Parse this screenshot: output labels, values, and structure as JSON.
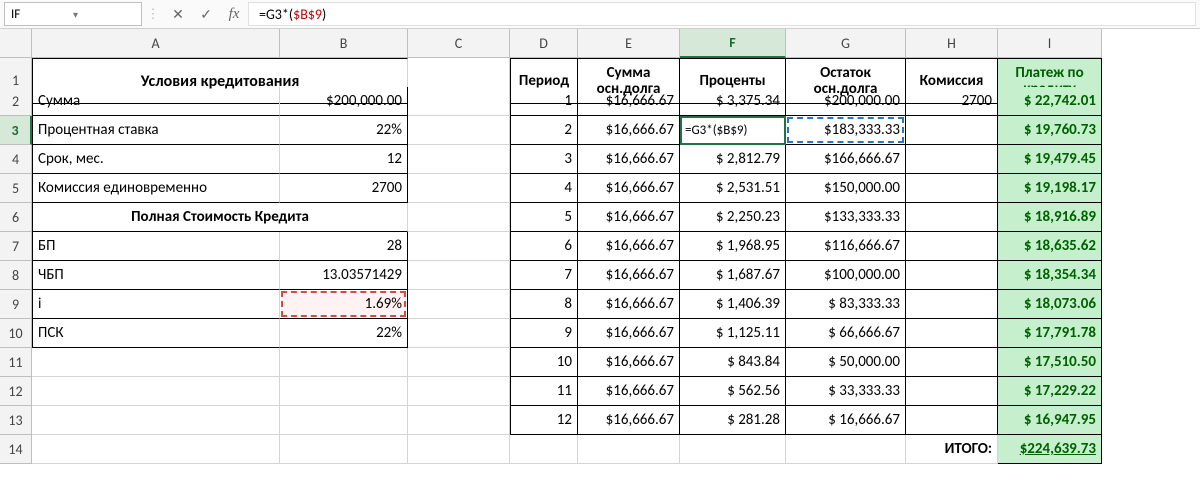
{
  "namebox": "IF",
  "formula": {
    "raw": "=G3*($B$9)",
    "prefix": "=G3*(",
    "abs": "$B$9",
    "suffix": ")"
  },
  "columns": [
    "A",
    "B",
    "C",
    "D",
    "E",
    "F",
    "G",
    "H",
    "I"
  ],
  "activeCol": "F",
  "rows": [
    "1",
    "2",
    "3",
    "4",
    "5",
    "6",
    "7",
    "8",
    "9",
    "10",
    "11",
    "12",
    "13",
    "14"
  ],
  "activeRow": "3",
  "left": {
    "title": "Условия кредитования",
    "rows": [
      {
        "label": "Сумма",
        "value": "$200,000.00"
      },
      {
        "label": "Процентная ставка",
        "value": "22%"
      },
      {
        "label": "Срок, мес.",
        "value": "12"
      },
      {
        "label": "Комиссия единовременно",
        "value": "2700"
      }
    ],
    "sub_title": "Полная Стоимость Кредита",
    "rows2": [
      {
        "label": "БП",
        "value": "28"
      },
      {
        "label": "ЧБП",
        "value": "13.03571429"
      },
      {
        "label": "i",
        "value": "1.69%"
      },
      {
        "label": "ПСК",
        "value": "22%"
      }
    ]
  },
  "right": {
    "headers": {
      "D": "Период",
      "E": "Сумма\nосн.долга",
      "F": "Проценты",
      "G": "Остаток\nосн.долга",
      "H": "Комиссия",
      "I": "Платеж по\nкредиту"
    },
    "rows": [
      {
        "n": "1",
        "E": "$16,666.67",
        "F": "$  3,375.34",
        "G": "$200,000.00",
        "H": "2700",
        "I": "$  22,742.01"
      },
      {
        "n": "2",
        "E": "$16,666.67",
        "F": "=G3*($B$9)",
        "G": "$183,333.33",
        "H": "",
        "I": "$  19,760.73"
      },
      {
        "n": "3",
        "E": "$16,666.67",
        "F": "$  2,812.79",
        "G": "$166,666.67",
        "H": "",
        "I": "$  19,479.45"
      },
      {
        "n": "4",
        "E": "$16,666.67",
        "F": "$  2,531.51",
        "G": "$150,000.00",
        "H": "",
        "I": "$  19,198.17"
      },
      {
        "n": "5",
        "E": "$16,666.67",
        "F": "$  2,250.23",
        "G": "$133,333.33",
        "H": "",
        "I": "$  18,916.89"
      },
      {
        "n": "6",
        "E": "$16,666.67",
        "F": "$  1,968.95",
        "G": "$116,666.67",
        "H": "",
        "I": "$  18,635.62"
      },
      {
        "n": "7",
        "E": "$16,666.67",
        "F": "$  1,687.67",
        "G": "$100,000.00",
        "H": "",
        "I": "$  18,354.34"
      },
      {
        "n": "8",
        "E": "$16,666.67",
        "F": "$  1,406.39",
        "G": "$  83,333.33",
        "H": "",
        "I": "$  18,073.06"
      },
      {
        "n": "9",
        "E": "$16,666.67",
        "F": "$  1,125.11",
        "G": "$  66,666.67",
        "H": "",
        "I": "$  17,791.78"
      },
      {
        "n": "10",
        "E": "$16,666.67",
        "F": "$     843.84",
        "G": "$  50,000.00",
        "H": "",
        "I": "$  17,510.50"
      },
      {
        "n": "11",
        "E": "$16,666.67",
        "F": "$     562.56",
        "G": "$  33,333.33",
        "H": "",
        "I": "$  17,229.22"
      },
      {
        "n": "12",
        "E": "$16,666.67",
        "F": "$     281.28",
        "G": "$  16,666.67",
        "H": "",
        "I": "$  16,947.95"
      }
    ],
    "total": {
      "label": "ИТОГО:",
      "value": "$224,639.73"
    }
  },
  "icons": {
    "cancel": "✕",
    "enter": "✓",
    "fx": "fx",
    "dropdown": "▾",
    "sep": "⋮"
  }
}
